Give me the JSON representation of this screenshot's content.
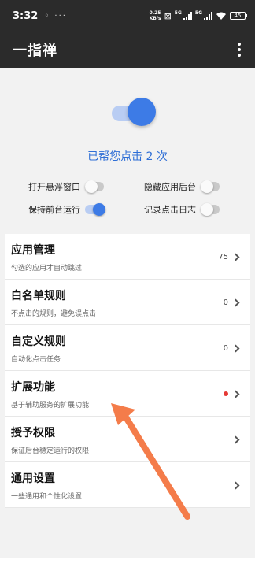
{
  "status_bar": {
    "time": "3:32",
    "left_icons": "◦ ···",
    "net_speed_value": "0.25",
    "net_speed_unit": "KB/s",
    "signal_tag": "5G",
    "signal_tag_2": "5G",
    "battery": "45"
  },
  "app_bar": {
    "title": "一指禅"
  },
  "main_toggle_on": true,
  "click_status": "已帮您点击 2 次",
  "options": [
    {
      "label": "打开悬浮窗口",
      "on": false
    },
    {
      "label": "隐藏应用后台",
      "on": false
    },
    {
      "label": "保持前台运行",
      "on": true
    },
    {
      "label": "记录点击日志",
      "on": false
    }
  ],
  "list": [
    {
      "title": "应用管理",
      "subtitle": "勾选的应用才自动跳过",
      "value": "75"
    },
    {
      "title": "白名单规则",
      "subtitle": "不点击的规则，避免误点击",
      "value": "0"
    },
    {
      "title": "自定义规则",
      "subtitle": "自动化点击任务",
      "value": "0"
    },
    {
      "title": "扩展功能",
      "subtitle": "基于辅助服务的扩展功能",
      "value": ""
    },
    {
      "title": "授予权限",
      "subtitle": "保证后台稳定运行的权限",
      "value": ""
    },
    {
      "title": "通用设置",
      "subtitle": "一些通用和个性化设置",
      "value": ""
    }
  ],
  "colors": {
    "accent": "#3d7be6",
    "arrow": "#f47c4a",
    "app_bar": "#2b2b2b"
  }
}
